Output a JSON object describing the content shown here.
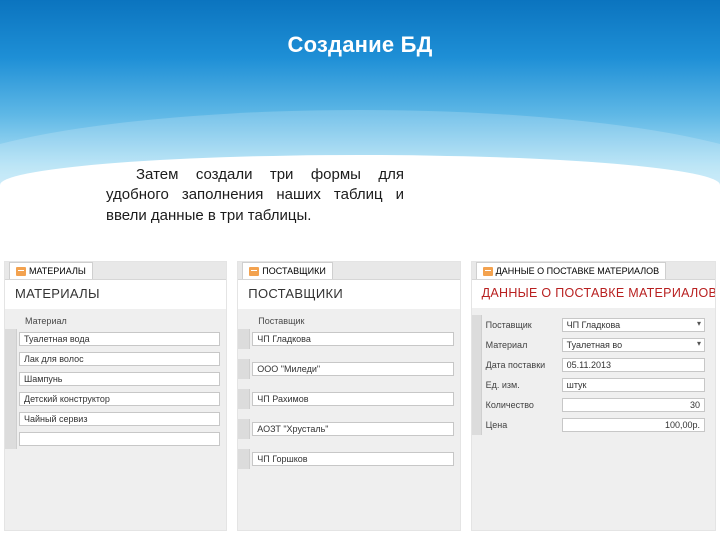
{
  "title": "Создание БД",
  "paragraph": "Затем создали три формы для удобного заполнения наших таблиц и ввели данные в три таблицы.",
  "forms": {
    "materials": {
      "tab": "МАТЕРИАЛЫ",
      "header": "МАТЕРИАЛЫ",
      "section_label": "Материал",
      "rows": [
        "Туалетная вода",
        "Лак для волос",
        "Шампунь",
        "Детский конструктор",
        "Чайный сервиз",
        ""
      ]
    },
    "suppliers": {
      "tab": "ПОСТАВЩИКИ",
      "header": "ПОСТАВЩИКИ",
      "section_label": "Поставщик",
      "rows": [
        "ЧП Гладкова",
        "ООО \"Миледи\"",
        "ЧП Рахимов",
        "АОЗТ \"Хрусталь\"",
        "ЧП Горшков"
      ]
    },
    "deliveries": {
      "tab": "ДАННЫЕ О ПОСТАВКЕ МАТЕРИАЛОВ",
      "header": "ДАННЫЕ О ПОСТАВКЕ МАТЕРИАЛОВ",
      "fields": [
        {
          "label": "Поставщик",
          "value": "ЧП Гладкова",
          "combo": true
        },
        {
          "label": "Материал",
          "value": "Туалетная во",
          "combo": true
        },
        {
          "label": "Дата поставки",
          "value": "05.11.2013"
        },
        {
          "label": "Ед. изм.",
          "value": "штук"
        },
        {
          "label": "Количество",
          "value": "30"
        },
        {
          "label": "Цена",
          "value": "100,00р."
        }
      ]
    }
  }
}
